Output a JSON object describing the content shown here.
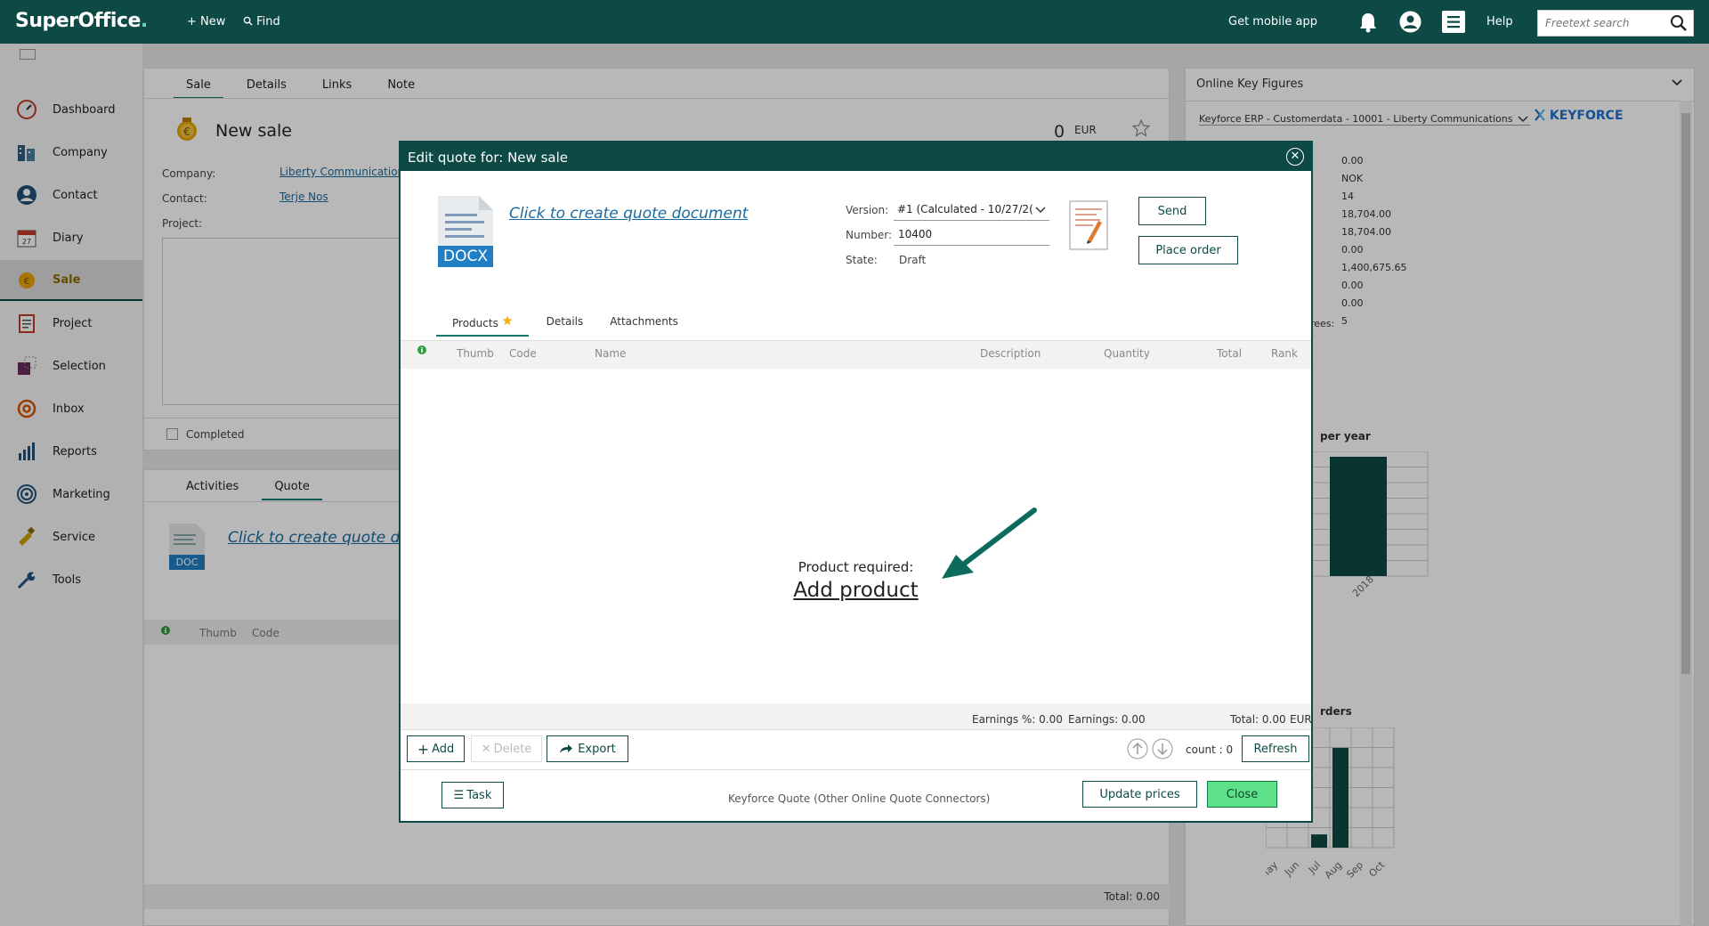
{
  "topbar": {
    "logo": "SuperOffice",
    "new_label": "New",
    "find_label": "Find",
    "mobile_label": "Get mobile app",
    "help_label": "Help",
    "search_placeholder": "Freetext search"
  },
  "sidebar": {
    "items": [
      {
        "label": "Dashboard",
        "icon": "dashboard-icon"
      },
      {
        "label": "Company",
        "icon": "company-icon"
      },
      {
        "label": "Contact",
        "icon": "contact-icon"
      },
      {
        "label": "Diary",
        "icon": "diary-icon"
      },
      {
        "label": "Sale",
        "icon": "sale-icon"
      },
      {
        "label": "Project",
        "icon": "project-icon"
      },
      {
        "label": "Selection",
        "icon": "selection-icon"
      },
      {
        "label": "Inbox",
        "icon": "inbox-icon"
      },
      {
        "label": "Reports",
        "icon": "reports-icon"
      },
      {
        "label": "Marketing",
        "icon": "marketing-icon"
      },
      {
        "label": "Service",
        "icon": "service-icon"
      },
      {
        "label": "Tools",
        "icon": "tools-icon"
      }
    ],
    "active_index": 4
  },
  "sale": {
    "tabs": [
      "Sale",
      "Details",
      "Links",
      "Note"
    ],
    "title": "New sale",
    "amount": "0",
    "currency": "EUR",
    "company_label": "Company:",
    "company_value": "Liberty Communication",
    "contact_label": "Contact:",
    "contact_value": "Terje Nos",
    "project_label": "Project:",
    "completed_label": "Completed"
  },
  "lower": {
    "tabs": [
      "Activities",
      "Quote"
    ],
    "doc_link": "Click to create quote doc",
    "doc_badge": "DOC",
    "col_thumb": "Thumb",
    "col_code": "Code",
    "total": "Total: 0.00"
  },
  "right": {
    "title": "Online Key Figures",
    "source": "Keyforce ERP - Customerdata - 10001 - Liberty Communications",
    "brand": "KEYFORCE",
    "values": [
      "0.00",
      "NOK",
      "14",
      "18,704.00",
      "18,704.00",
      "0.00",
      "1,400,675.65",
      "0.00",
      "0.00",
      "5"
    ],
    "partial_label": "rees:",
    "chart1_title": "per year",
    "chart1_tick": "2018",
    "chart2_title": "rders",
    "chart2_ticks": [
      "May",
      "Jun",
      "Jul",
      "Aug",
      "Sep",
      "Oct"
    ]
  },
  "chart_data": [
    {
      "type": "bar",
      "title": "",
      "categories": [
        "2018"
      ],
      "values": [
        1
      ]
    },
    {
      "type": "bar",
      "title": "",
      "categories": [
        "May",
        "Jun",
        "Jul",
        "Aug",
        "Sep",
        "Oct"
      ],
      "values": [
        0,
        0,
        0.11,
        0.83,
        0,
        0
      ]
    }
  ],
  "modal": {
    "title": "Edit quote for: New sale",
    "doc_badge": "DOCX",
    "doc_link": "Click to create quote document",
    "version_label": "Version:",
    "version_value": "#1 (Calculated - 10/27/2(",
    "number_label": "Number:",
    "number_value": "10400",
    "state_label": "State:",
    "state_value": "Draft",
    "send_label": "Send",
    "place_order_label": "Place order",
    "tabs": [
      "Products",
      "Details",
      "Attachments"
    ],
    "columns": [
      "Thumb",
      "Code",
      "Name",
      "Description",
      "Quantity",
      "Total",
      "Rank"
    ],
    "product_required": "Product required:",
    "add_product": "Add product",
    "earnings_pct": "Earnings %: 0.00",
    "earnings": "Earnings: 0.00",
    "total": "Total: 0.00",
    "total_currency": "EUR",
    "add_label": "Add",
    "delete_label": "Delete",
    "export_label": "Export",
    "count_label": "count : 0",
    "refresh_label": "Refresh",
    "task_label": "Task",
    "connector_label": "Keyforce Quote (Other Online Quote Connectors)",
    "update_prices_label": "Update prices",
    "close_label": "Close"
  }
}
